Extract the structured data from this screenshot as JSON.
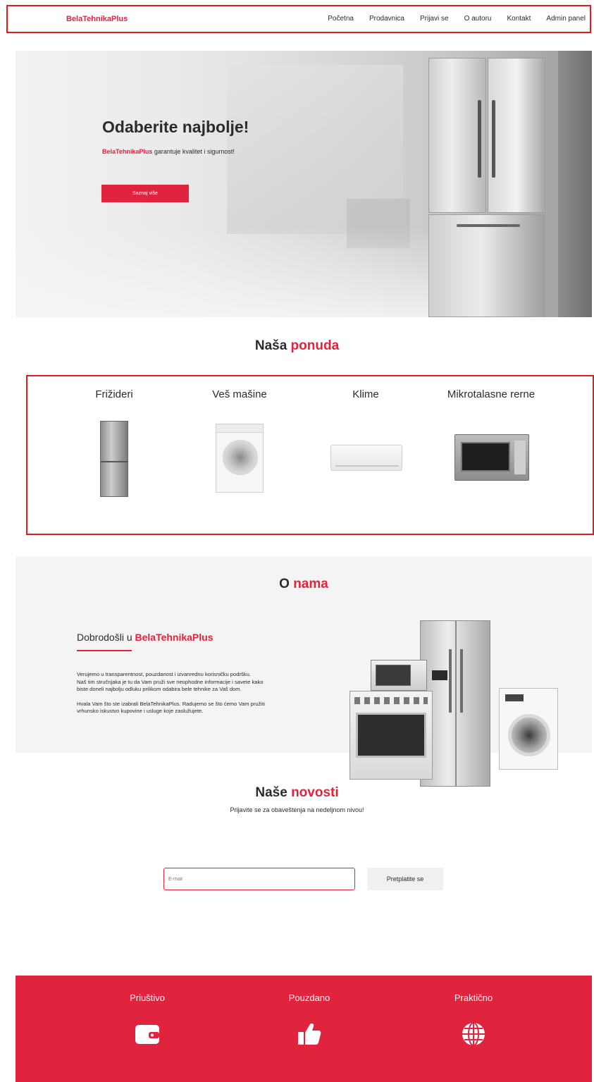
{
  "nav": {
    "brand": "BelaTehnikaPlus",
    "items": [
      "Početna",
      "Prodavnica",
      "Prijavi se",
      "O autoru",
      "Kontakt",
      "Admin panel"
    ]
  },
  "hero": {
    "title": "Odaberite najbolje!",
    "subtitle_brand": "BelaTehnikaPlus",
    "subtitle_rest": " garantuje kvalitet i sigurnost!",
    "button": "Saznaj više"
  },
  "offer": {
    "title_a": "Naša ",
    "title_b": "ponuda",
    "items": [
      {
        "label": "Frižideri",
        "icon": "fridge-image"
      },
      {
        "label": "Veš mašine",
        "icon": "washing-machine-image"
      },
      {
        "label": "Klime",
        "icon": "air-conditioner-image"
      },
      {
        "label": "Mikrotalasne rerne",
        "icon": "microwave-image"
      }
    ]
  },
  "about": {
    "title_a": "O ",
    "title_b": "nama",
    "heading_a": "Dobrodošli u ",
    "heading_b": "BelaTehnikaPlus",
    "p1": "Verujemo u transparentnost, pouzdanost i izvanrednu korisničku podršku.",
    "p2": "Naš tim stručnjaka je tu da Vam pruži sve neophodne informacije i savete kako biste doneli najbolju odluku prilikom odabira bele tehnike za Vaš dom.",
    "p3": "Hvala Vam što ste izabrali BelaTehnikaPlus. Radujemo se što ćemo Vam pružiti vrhunsko iskustvo kupovine i usluge koje zaslužujete."
  },
  "news": {
    "title_a": "Naše ",
    "title_b": "novosti",
    "subtitle": "Prijavite se za obaveštenja na nedeljnom nivou!",
    "input_placeholder": "E-mail",
    "button": "Pretplatite se"
  },
  "features": [
    {
      "label": "Priuštivo",
      "icon": "wallet-icon"
    },
    {
      "label": "Pouzdano",
      "icon": "thumbs-up-icon"
    },
    {
      "label": "Praktično",
      "icon": "globe-icon"
    }
  ],
  "colors": {
    "accent": "#e0243e",
    "highlight_border": "#e11b22"
  }
}
